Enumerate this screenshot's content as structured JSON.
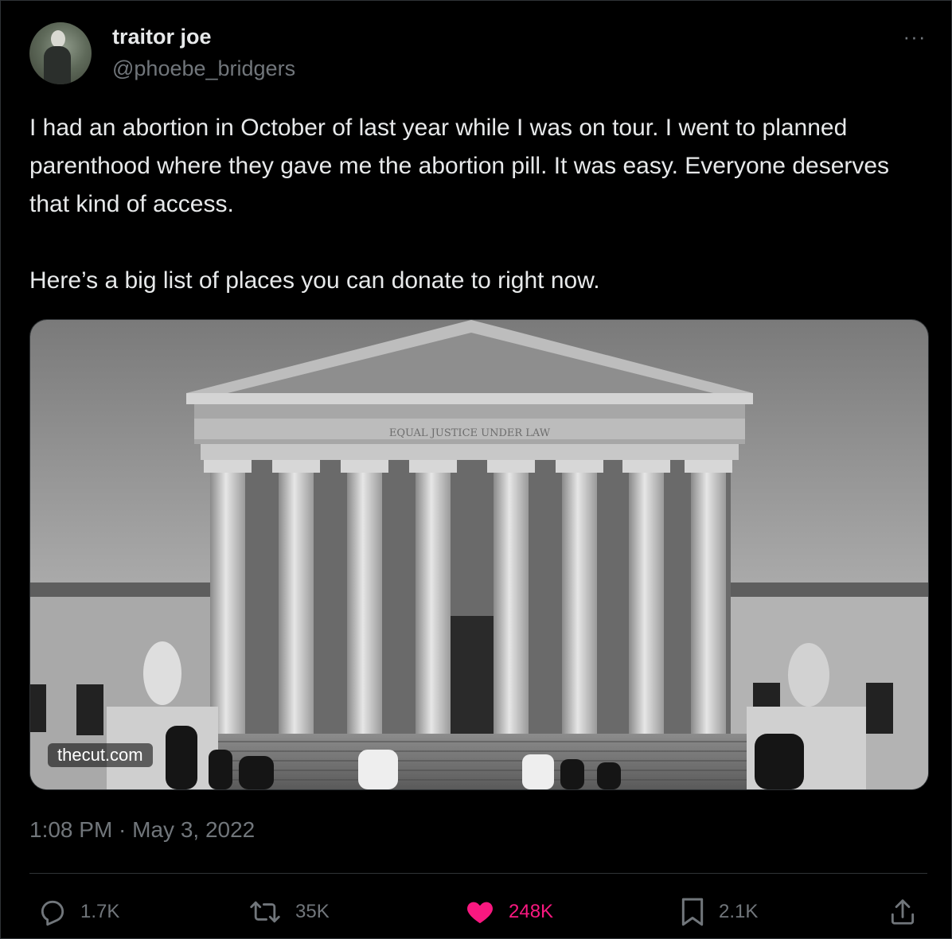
{
  "author": {
    "display_name": "traitor joe",
    "handle": "@phoebe_bridgers"
  },
  "tweet": {
    "paragraph_1": "I had an abortion in October of last year while I was on tour. I went to planned parenthood where they gave me the abortion pill. It was easy. Everyone deserves that kind of access.",
    "paragraph_2": "Here’s a big list of places you can donate to right now.",
    "media": {
      "domain": "thecut.com",
      "inscription": "EQUAL JUSTICE UNDER LAW"
    },
    "timestamp": "1:08 PM · May 3, 2022"
  },
  "actions": {
    "reply": {
      "icon": "reply-icon",
      "count": "1.7K"
    },
    "retweet": {
      "icon": "retweet-icon",
      "count": "35K"
    },
    "like": {
      "icon": "heart-icon",
      "count": "248K",
      "color": "#f91880",
      "active": true
    },
    "bookmark": {
      "icon": "bookmark-icon",
      "count": "2.1K"
    },
    "share": {
      "icon": "share-icon"
    }
  },
  "more_menu": {
    "icon": "more-icon",
    "label": "···"
  }
}
